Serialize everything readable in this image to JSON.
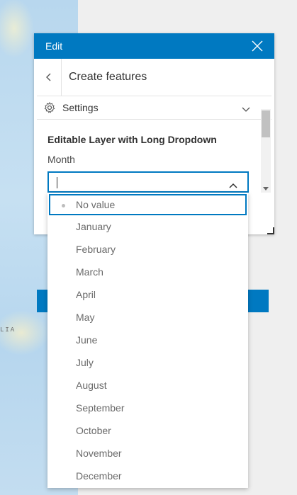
{
  "panel": {
    "header_title": "Edit",
    "subheader_title": "Create features",
    "settings_label": "Settings",
    "layer_title": "Editable Layer with Long Dropdown",
    "field_label": "Month"
  },
  "map": {
    "label": "LIA"
  },
  "dropdown": {
    "options": [
      "No value",
      "January",
      "February",
      "March",
      "April",
      "May",
      "June",
      "July",
      "August",
      "September",
      "October",
      "November",
      "December"
    ]
  },
  "colors": {
    "accent": "#0079c1"
  },
  "icons": {
    "close": "close-icon",
    "back": "chevron-left-icon",
    "settings": "gear-icon",
    "expand": "chevron-down-icon",
    "combo": "chevron-up-icon"
  }
}
